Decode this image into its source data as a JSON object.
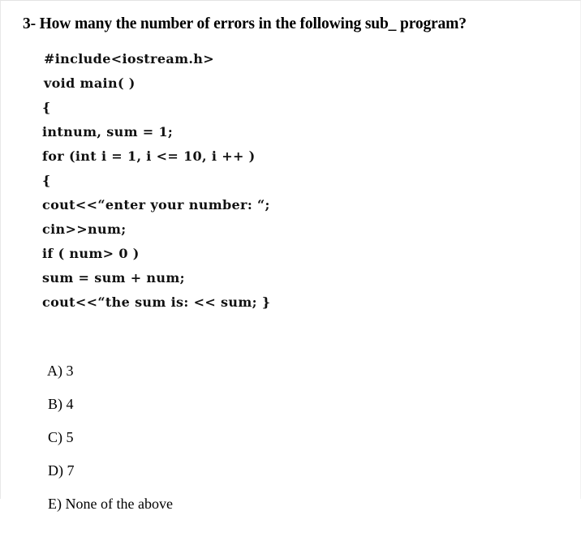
{
  "document": {
    "question_number": "3-",
    "question_text": "3- How many the number of errors in the following sub_ program?",
    "code_lines": [
      "#include<iostream.h>",
      "void main( )",
      "{",
      "intnum, sum = 1;",
      "for (int i = 1, i <= 10, i ++ )",
      "{",
      "cout<<“enter your number: “;",
      "cin>>num;",
      "if ( num> 0 )",
      "sum = sum + num;",
      "cout<<“the sum is: << sum; }"
    ],
    "options": [
      {
        "label": "A)",
        "text": "3"
      },
      {
        "label": "B)",
        "text": "4"
      },
      {
        "label": "C)",
        "text": "5"
      },
      {
        "label": "D)",
        "text": "7"
      },
      {
        "label": "E)",
        "text": "None of the above"
      }
    ]
  },
  "colors": {
    "page_background": "#ffffff",
    "text": "#000000",
    "code_text": "#111111",
    "border": "#e3e3e3"
  }
}
